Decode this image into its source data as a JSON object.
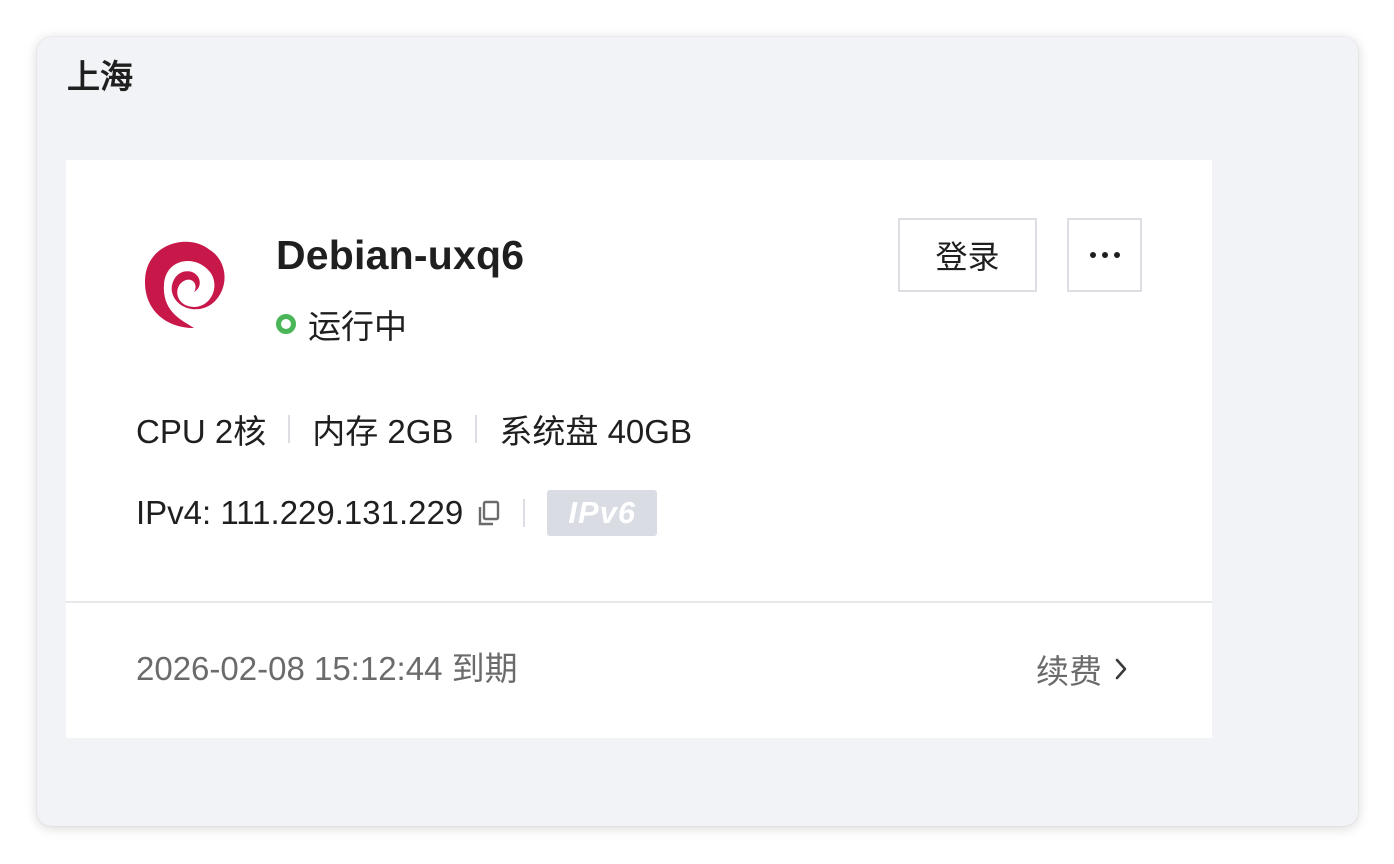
{
  "region": {
    "title": "上海"
  },
  "instance": {
    "name": "Debian-uxq6",
    "os_icon": "debian-logo",
    "status": {
      "label": "运行中",
      "color": "#4ab657"
    },
    "actions": {
      "login_label": "登录",
      "more_icon": "ellipsis-icon"
    },
    "specs": {
      "cpu": "CPU 2核",
      "memory": "内存 2GB",
      "disk": "系统盘 40GB"
    },
    "network": {
      "ipv4": "IPv4: 111.229.131.229",
      "copy_icon": "copy-icon",
      "ipv6_badge": "IPv6"
    },
    "footer": {
      "expire_text": "2026-02-08 15:12:44 到期",
      "renew_label": "续费",
      "renew_icon": "chevron-right-icon"
    }
  },
  "colors": {
    "window_bg": "#f2f3f7",
    "card_bg": "#ffffff",
    "debian_red": "#c8184a",
    "badge_bg": "#d9dce3",
    "muted_text": "#6b6b6b"
  }
}
